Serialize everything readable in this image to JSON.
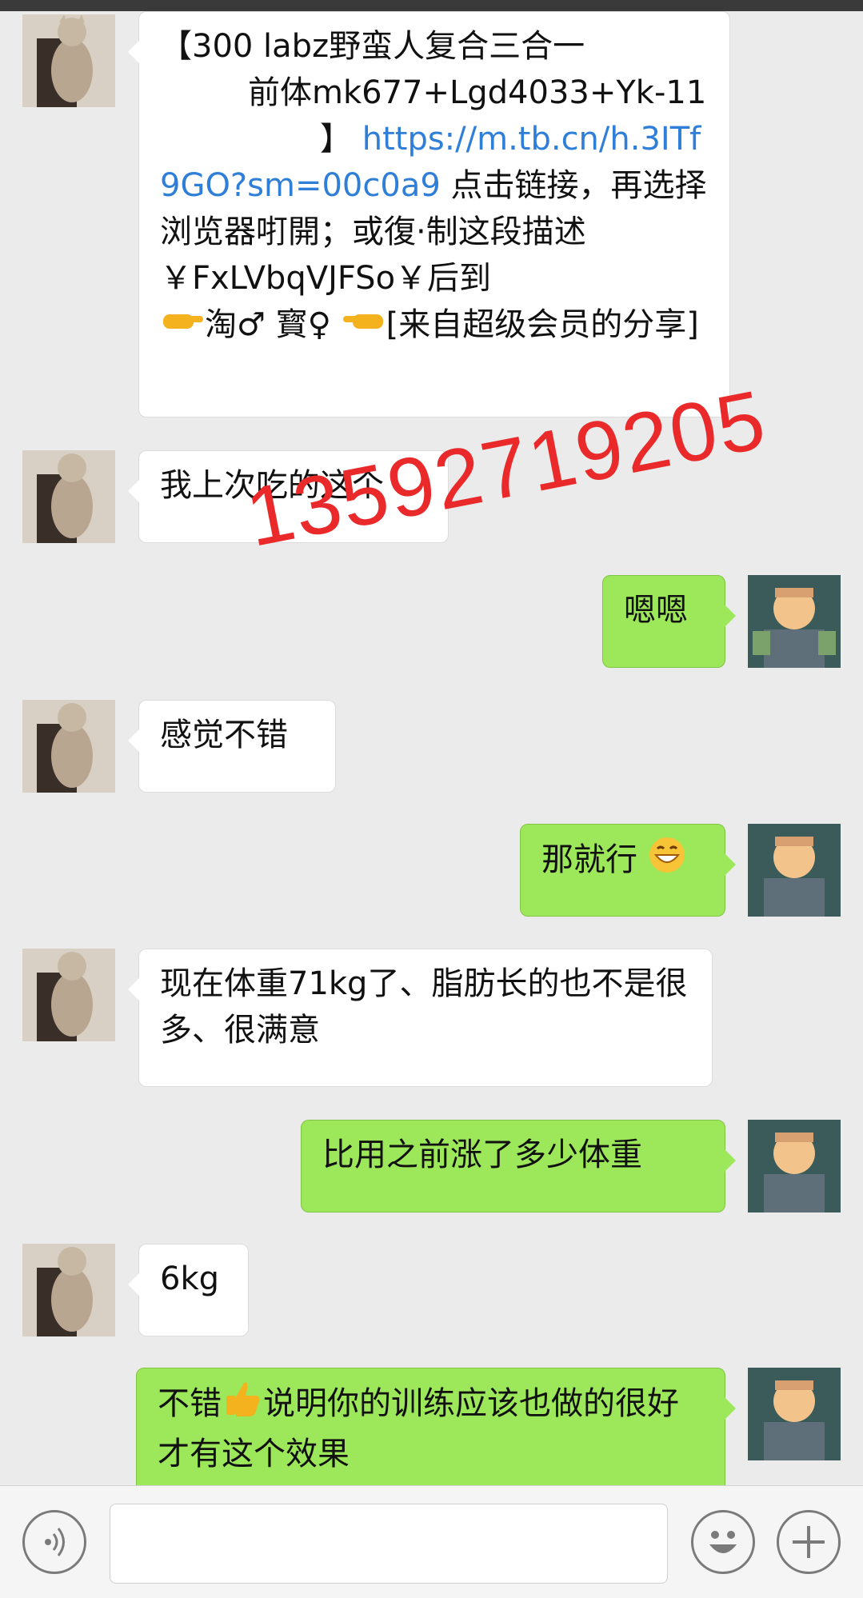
{
  "messages": [
    {
      "side": "in",
      "parts": [
        "【300 labz野蛮人复合三合一",
        "前体mk677+Lgd4033+Yk-11",
        "】",
        "https://m.tb.cn/h.3ITf9GO?sm=00c0a9",
        "点击链接，再选择浏览器咑開；或復·制这段描述￥FxLVbqVJFSo￥后到",
        "淘♂ 寳♀",
        "[来自超级会员的分享]"
      ]
    },
    {
      "side": "in",
      "text": "我上次吃的这个"
    },
    {
      "side": "out",
      "text": "嗯嗯"
    },
    {
      "side": "in",
      "text": "感觉不错"
    },
    {
      "side": "out",
      "text": "那就行"
    },
    {
      "side": "in",
      "text": "现在体重71kg了、脂肪长的也不是很多、很满意"
    },
    {
      "side": "out",
      "text": "比用之前涨了多少体重"
    },
    {
      "side": "in",
      "text": "6kg"
    },
    {
      "side": "out",
      "text_a": "不错",
      "text_b": "说明你的训练应该也做的很好才有这个效果"
    }
  ],
  "watermark": "13592719205",
  "icons": {
    "contact_avatar": "cat-avatar-icon",
    "self_avatar": "cartoon-man-avatar-icon",
    "voice": "voice-icon",
    "emoji": "emoji-icon",
    "plus": "plus-icon",
    "grin": "grin-emoji-icon",
    "thumbs": "thumbs-up-icon",
    "point_right": "point-right-icon",
    "point_left": "point-left-icon"
  },
  "colors": {
    "outgoing": "#9de75a",
    "incoming": "#ffffff",
    "link": "#2f7ed8",
    "watermark": "#ea2a2a",
    "background": "#ebebeb"
  }
}
